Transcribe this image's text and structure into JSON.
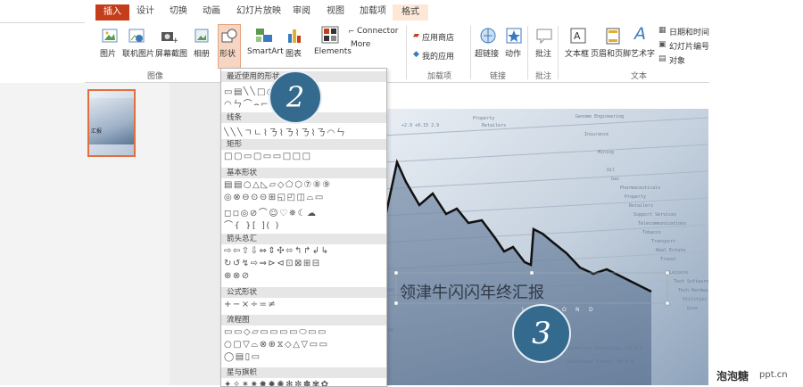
{
  "ribbon": {
    "tabs": [
      {
        "label": "插入",
        "active": true
      },
      {
        "label": "设计"
      },
      {
        "label": "切换"
      },
      {
        "label": "动画"
      },
      {
        "label": "幻灯片放映"
      },
      {
        "label": "审阅"
      },
      {
        "label": "视图"
      },
      {
        "label": "加载项"
      },
      {
        "label": "格式"
      }
    ],
    "buttons": {
      "picture": "图片",
      "online_picture": "联机图片",
      "screenshot": "屏幕截图",
      "album": "相册",
      "shapes": "形状",
      "smartart": "SmartArt",
      "chart": "图表",
      "elements": "Elements",
      "connector": "Connector",
      "more": "More",
      "store": "应用商店",
      "my_apps": "我的应用",
      "hyperlink": "超链接",
      "action": "动作",
      "comment": "批注",
      "textbox": "文本框",
      "header_footer": "页眉和页脚",
      "wordart": "艺术字",
      "datetime": "日期和时间",
      "slide_number": "幻灯片编号",
      "object": "对象"
    },
    "groups": {
      "images": "图像",
      "addins": "加载项",
      "links": "链接",
      "comments": "批注",
      "text": "文本"
    }
  },
  "shapes_menu": {
    "sections": [
      {
        "title": "最近使用的形状",
        "rows": [
          "▭▤╲╲□○△ㄱㄴ⇨⇩",
          "◠ㄣ⌒⌢⌐◜"
        ]
      },
      {
        "title": "线条",
        "rows": [
          "╲╲╲ㄱㄴ⌇ㄋ⌇ㄋ⌇ㄋ⌇ㄋ◠ㄣ"
        ]
      },
      {
        "title": "矩形",
        "rows": [
          "□▢▭▢▭▭□□□"
        ]
      },
      {
        "title": "基本形状",
        "rows": [
          "▤▤○△◺▱◇⬠⬡⑦⑧⑨",
          "◎⊗⊖⊙⊝⊞◱◰◫⌓▭",
          "◻◽◎⊘⌒☺♡✵☾☁",
          "⌒{ }[ ]( )"
        ]
      },
      {
        "title": "箭头总汇",
        "rows": [
          "⇨⇦⇧⇩⇔⇕✣⬄↰↱↲↳",
          "↻↺↯⇨⇒⊳⊲⊡⊠⊞⊟",
          "⊕⊗⊘"
        ]
      },
      {
        "title": "公式形状",
        "rows": [
          "+−×÷=≠"
        ]
      },
      {
        "title": "流程图",
        "rows": [
          "▭▭◇▱▭▭▭▭⬭▭▭",
          "○▢▽⌓⊗⊕⧖◇△▽▭▭",
          "◯▤▯▭"
        ]
      },
      {
        "title": "星与旗帜",
        "rows": [
          "✦✧✶✷✸✹✺✻✼✽✾✿"
        ]
      }
    ]
  },
  "slide": {
    "title_text": "领津牛闪闪年终汇报"
  },
  "thumbnail": {
    "label": "汇报"
  },
  "badges": [
    "2",
    "3"
  ],
  "watermark": {
    "text": "泡泡糖",
    "domain": "ppt.cn"
  },
  "colors": {
    "accent": "#c43e1c",
    "badge": "#356a8f"
  }
}
